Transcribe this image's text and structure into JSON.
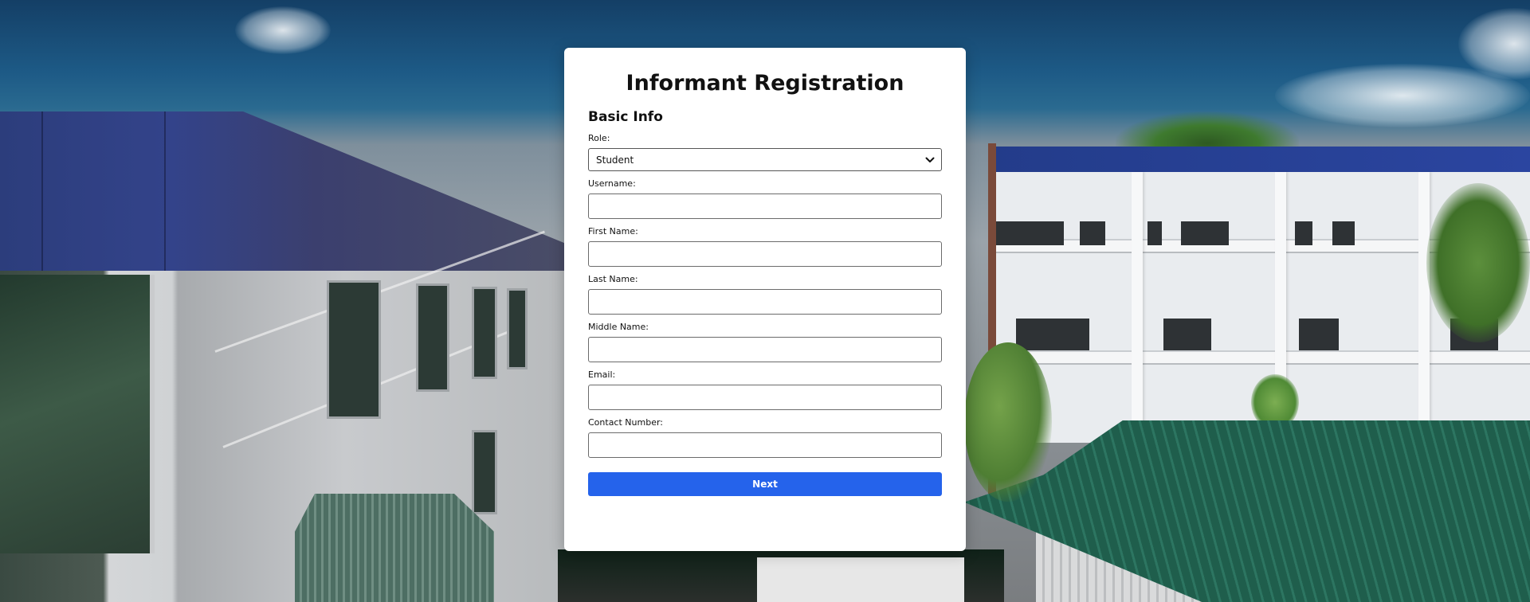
{
  "page": {
    "title": "Informant Registration",
    "section_heading": "Basic Info"
  },
  "form": {
    "role": {
      "label": "Role:",
      "selected": "Student"
    },
    "username": {
      "label": "Username:",
      "value": "",
      "placeholder": ""
    },
    "first_name": {
      "label": "First Name:",
      "value": "",
      "placeholder": ""
    },
    "last_name": {
      "label": "Last Name:",
      "value": "",
      "placeholder": ""
    },
    "middle_name": {
      "label": "Middle Name:",
      "value": "",
      "placeholder": ""
    },
    "email": {
      "label": "Email:",
      "value": "",
      "placeholder": ""
    },
    "contact_number": {
      "label": "Contact Number:",
      "value": "",
      "placeholder": ""
    },
    "next_label": "Next"
  },
  "colors": {
    "primary_button": "#2563eb",
    "card_background": "#ffffff"
  },
  "icons": {
    "role_select": "chevron-down-icon"
  }
}
